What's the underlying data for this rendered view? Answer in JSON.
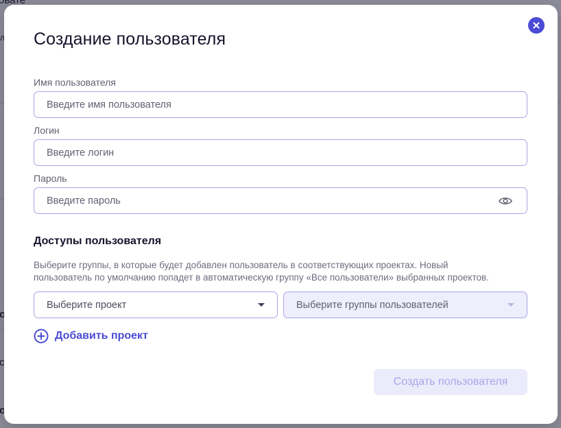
{
  "background": {
    "fragments": [
      "овате",
      "л",
      "о",
      "с",
      "о"
    ]
  },
  "modal": {
    "title": "Создание пользователя",
    "close_icon": "close-icon",
    "fields": {
      "name": {
        "label": "Имя пользователя",
        "placeholder": "Введите имя пользователя"
      },
      "login": {
        "label": "Логин",
        "placeholder": "Введите логин"
      },
      "password": {
        "label": "Пароль",
        "placeholder": "Введите пароль",
        "icon": "eye-icon"
      }
    },
    "access": {
      "title": "Доступы пользователя",
      "description_line1": "Выберите группы, в которые будет добавлен пользователь в соответствующих проектах. Новый",
      "description_line2": "пользователь по умолчанию попадет в автоматическую группу «Все пользователи» выбранных проектов.",
      "project_select": {
        "placeholder": "Выберите проект",
        "icon": "chevron-down-icon"
      },
      "groups_select": {
        "placeholder": "Выберите группы пользователей",
        "disabled": true,
        "icon": "chevron-down-icon"
      },
      "add_project": {
        "label": "Добавить проект",
        "icon": "plus-circle-icon"
      }
    },
    "submit_label": "Создать пользователя"
  },
  "colors": {
    "accent": "#4b4bd6",
    "border": "#a9a4e6",
    "disabled_bg": "#ebebfb",
    "disabled_text": "#a9a7e8"
  }
}
